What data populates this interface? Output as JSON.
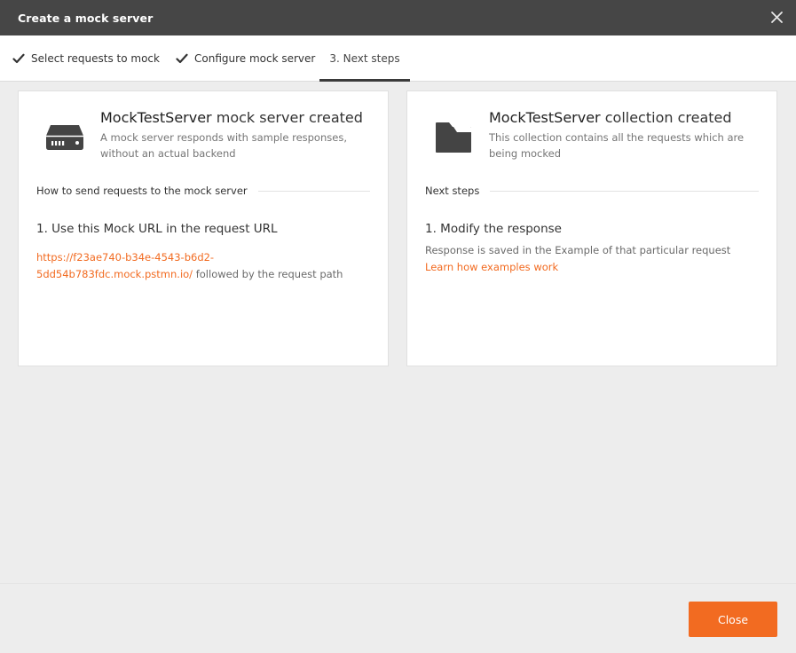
{
  "dialog": {
    "title": "Create a mock server",
    "close_icon": "close-icon"
  },
  "steps": [
    {
      "label": "Select requests to mock",
      "done": true,
      "icon": "check-icon"
    },
    {
      "label": "Configure mock server",
      "done": true,
      "icon": "check-icon"
    },
    {
      "label": "3. Next steps",
      "done": false,
      "active": true
    }
  ],
  "left_card": {
    "icon": "server-icon",
    "name": "MockTestServer",
    "headline_suffix": " mock server created",
    "description": "A mock server responds with sample responses, without an actual backend",
    "section_label": "How to send requests to the mock server",
    "step_title": "1. Use this Mock URL in the request URL",
    "mock_url_line1": "https://f23ae740-b34e-4543-b6d2-",
    "mock_url_line2": "5dd54b783fdc.mock.pstmn.io/",
    "url_suffix": " followed by the request path"
  },
  "right_card": {
    "icon": "folder-icon",
    "name": "MockTestServer",
    "headline_suffix": " collection created",
    "description": "This collection contains all the requests which are being mocked",
    "section_label": "Next steps",
    "step_title": "1. Modify the response",
    "step_text": "Response is saved in the Example of that particular request",
    "link_text": "Learn how examples work"
  },
  "footer": {
    "close_label": "Close"
  },
  "colors": {
    "accent": "#f26b21",
    "titlebar": "#464646",
    "background": "#ededed"
  }
}
